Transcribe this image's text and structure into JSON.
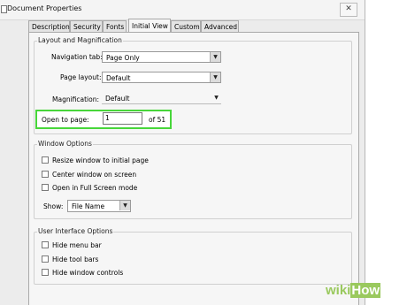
{
  "window": {
    "title": "Document Properties",
    "close_glyph": "✕"
  },
  "tabs": [
    {
      "label": "Description",
      "active": false
    },
    {
      "label": "Security",
      "active": false
    },
    {
      "label": "Fonts",
      "active": false
    },
    {
      "label": "Initial View",
      "active": true
    },
    {
      "label": "Custom",
      "active": false
    },
    {
      "label": "Advanced",
      "active": false
    }
  ],
  "layout_magnification": {
    "title": "Layout and Magnification",
    "navigation_tab": {
      "label": "Navigation tab:",
      "value": "Page Only"
    },
    "page_layout": {
      "label": "Page layout:",
      "value": "Default"
    },
    "magnification": {
      "label": "Magnification:",
      "value": "Default"
    },
    "open_to_page": {
      "label": "Open to page:",
      "value": "1",
      "of_label": "of 51"
    }
  },
  "window_options": {
    "title": "Window Options",
    "checkboxes": [
      {
        "label": "Resize window to initial page",
        "checked": false
      },
      {
        "label": "Center window on screen",
        "checked": false
      },
      {
        "label": "Open in Full Screen mode",
        "checked": false
      }
    ],
    "show": {
      "label": "Show:",
      "value": "File Name"
    }
  },
  "ui_options": {
    "title": "User Interface Options",
    "checkboxes": [
      {
        "label": "Hide menu bar",
        "checked": false
      },
      {
        "label": "Hide tool bars",
        "checked": false
      },
      {
        "label": "Hide window controls",
        "checked": false
      }
    ]
  },
  "watermark": {
    "wiki": "wiki",
    "how": "How"
  },
  "colors": {
    "highlight": "#47d63a",
    "watermark": "#9ac95e"
  }
}
